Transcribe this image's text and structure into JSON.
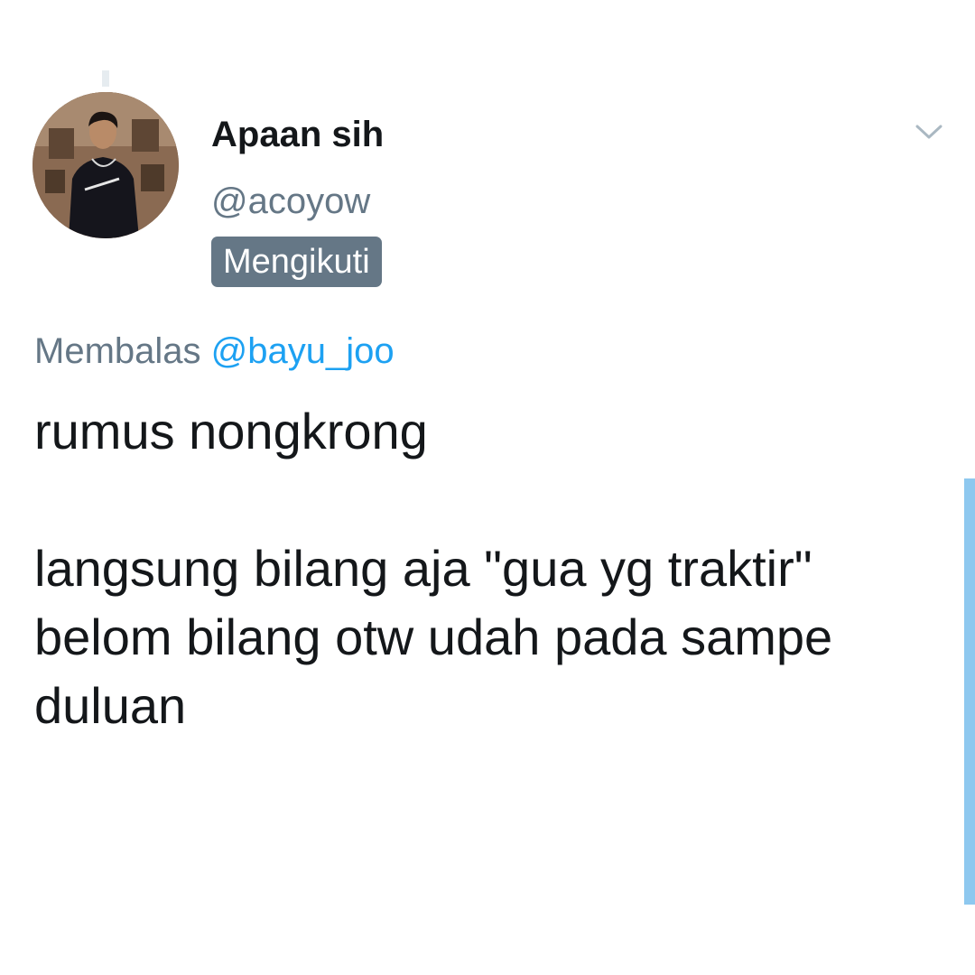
{
  "tweet": {
    "author": {
      "display_name": "Apaan sih",
      "handle": "@acoyow",
      "follow_status": "Mengikuti"
    },
    "reply_prefix": "Membalas ",
    "reply_to": "@bayu_joo",
    "text": "rumus nongkrong\n\nlangsung bilang aja \"gua yg traktir\"\nbelom bilang otw udah pada sampe duluan"
  },
  "icons": {
    "menu": "chevron-down-icon"
  },
  "colors": {
    "text_primary": "#14171a",
    "text_secondary": "#657786",
    "mention": "#1da1f2",
    "badge_bg": "#657786",
    "scrollbar": "#8ec8ef"
  }
}
